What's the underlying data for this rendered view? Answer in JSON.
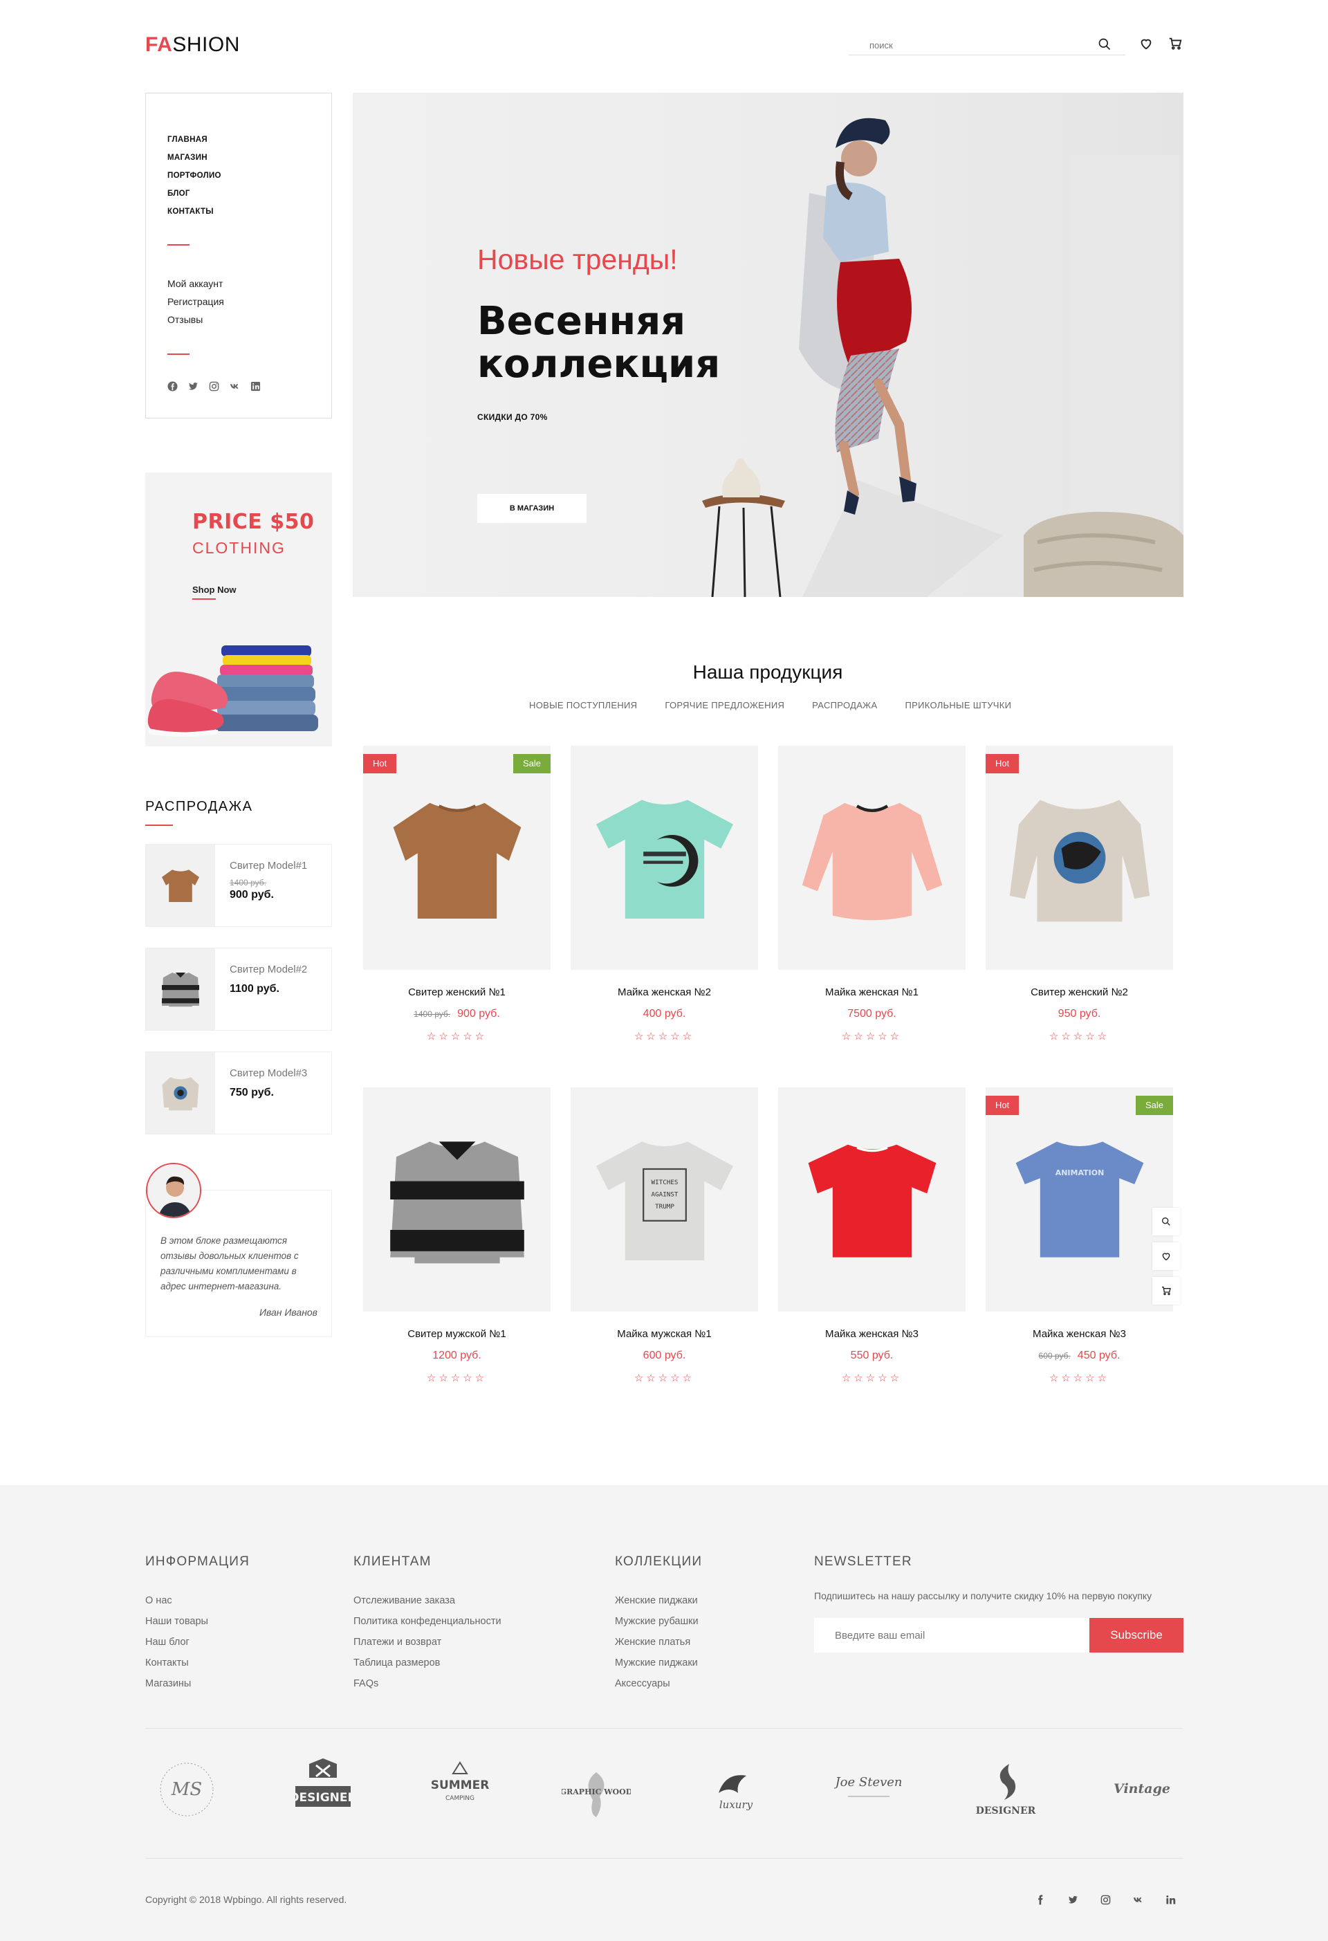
{
  "header": {
    "logo_accent": "FA",
    "logo_rest": "SHION",
    "search_placeholder": "поиск"
  },
  "sidebar": {
    "menu": [
      "ГЛАВНАЯ",
      "МАГАЗИН",
      "ПОРТФОЛИО",
      "БЛОГ",
      "КОНТАКТЫ"
    ],
    "account": [
      "Мой аккаунт",
      "Регистрация",
      "Отзывы"
    ],
    "social_icons": [
      "facebook-icon",
      "twitter-icon",
      "instagram-icon",
      "vk-icon",
      "linkedin-icon"
    ]
  },
  "promo": {
    "price": "PRICE $50",
    "category": "CLOTHING",
    "cta": "Shop Now"
  },
  "sale": {
    "title": "РАСПРОДАЖА",
    "items": [
      {
        "name": "Свитер Model#1",
        "old_price": "1400 руб.",
        "price": "900 руб."
      },
      {
        "name": "Свитер Model#2",
        "old_price": "",
        "price": "1100 руб."
      },
      {
        "name": "Свитер Model#3",
        "old_price": "",
        "price": "750 руб."
      }
    ]
  },
  "testimonial": {
    "text": "В этом блоке размещаются отзывы довольных клиентов с различными комплиментами в адрес интернет-магазина.",
    "author": "Иван Иванов"
  },
  "hero": {
    "subtitle": "Новые тренды!",
    "title_line1": "Весенняя",
    "title_line2": "коллекция",
    "discount": "СКИДКИ ДО 70%",
    "button": "В МАГАЗИН"
  },
  "products_section": {
    "title": "Наша продукция",
    "tabs": [
      "НОВЫЕ ПОСТУПЛЕНИЯ",
      "ГОРЯЧИЕ ПРЕДЛОЖЕНИЯ",
      "РАСПРОДАЖА",
      "ПРИКОЛЬНЫЕ ШТУЧКИ"
    ],
    "products": [
      {
        "name": "Свитер женский №1",
        "old_price": "1400 руб.",
        "price": "900 руб.",
        "hot": "Hot",
        "sale": "Sale",
        "rating": 0
      },
      {
        "name": "Майка женская №2",
        "old_price": "",
        "price": "400 руб.",
        "hot": "",
        "sale": "",
        "rating": 0
      },
      {
        "name": "Майка женская №1",
        "old_price": "",
        "price": "7500 руб.",
        "hot": "",
        "sale": "",
        "rating": 0
      },
      {
        "name": "Свитер женский №2",
        "old_price": "",
        "price": "950 руб.",
        "hot": "Hot",
        "sale": "",
        "rating": 0
      },
      {
        "name": "Свитер мужской №1",
        "old_price": "",
        "price": "1200 руб.",
        "hot": "",
        "sale": "",
        "rating": 0
      },
      {
        "name": "Майка мужская №1",
        "old_price": "",
        "price": "600 руб.",
        "hot": "",
        "sale": "",
        "rating": 0
      },
      {
        "name": "Майка женская №3",
        "old_price": "",
        "price": "550 руб.",
        "hot": "",
        "sale": "",
        "rating": 0
      },
      {
        "name": "Майка женская №3",
        "old_price": "600 руб.",
        "price": "450 руб.",
        "hot": "Hot",
        "sale": "Sale",
        "rating": 0
      }
    ],
    "tshirt_prints": [
      "WITCHES",
      "AGAINST",
      "TRUMP",
      "ANIMATION"
    ]
  },
  "footer": {
    "info": {
      "title": "ИНФОРМАЦИЯ",
      "links": [
        "О нас",
        "Наши товары",
        "Наш блог",
        "Контакты",
        "Магазины"
      ]
    },
    "clients": {
      "title": "КЛИЕНТАМ",
      "links": [
        "Отслеживание заказа",
        "Политика конфеденциальности",
        "Платежи и возврат",
        "Таблица размеров",
        "FAQs"
      ]
    },
    "collections": {
      "title": "КОЛЛЕКЦИИ",
      "links": [
        "Женские пиджаки",
        "Мужские рубашки",
        "Женские платья",
        "Мужские пиджаки",
        "Аксессуары"
      ]
    },
    "newsletter": {
      "title": "NEWSLETTER",
      "text": "Подпишитесь на нашу рассылку и получите скидку 10% на первую покупку",
      "placeholder": "Введите ваш email",
      "button": "Subscribe"
    },
    "brands": [
      "MS",
      "DESIGNER",
      "SUMMER",
      "CAMPING",
      "GRAPHIC WOOD",
      "luxury",
      "Joe Steven",
      "DESIGNER",
      "Vintage"
    ],
    "copyright": "Copyright © 2018 Wpbingo. All rights reserved.",
    "social_icons": [
      "facebook-icon",
      "twitter-icon",
      "instagram-icon",
      "vk-icon",
      "linkedin-icon"
    ]
  },
  "colors": {
    "accent": "#e5484d",
    "sale": "#7aac3c",
    "footer_bg": "#f4f4f4"
  }
}
